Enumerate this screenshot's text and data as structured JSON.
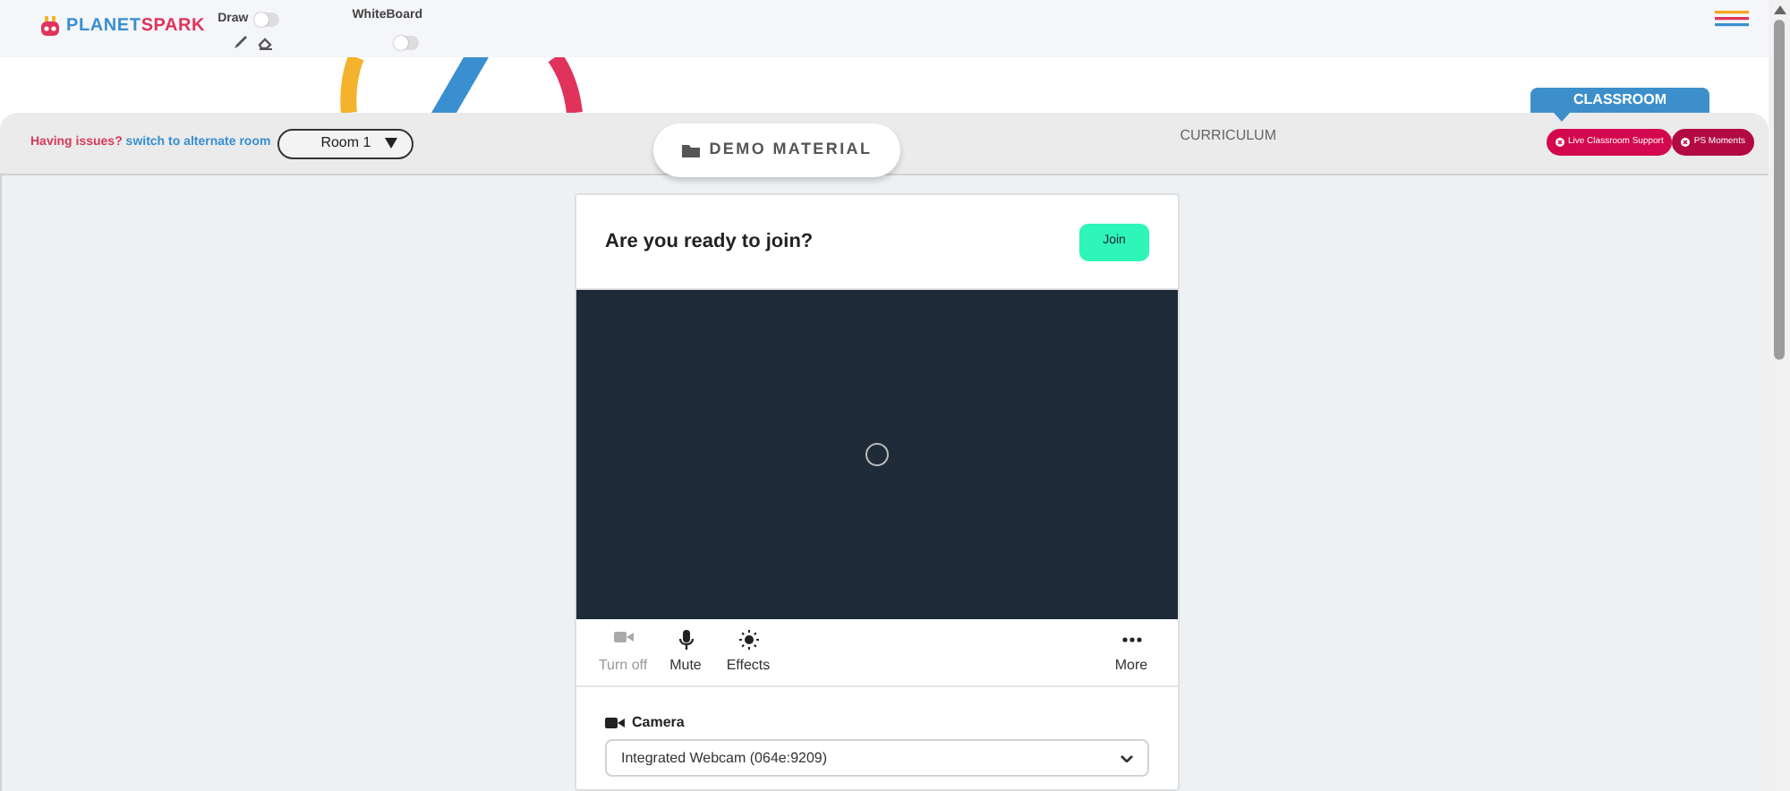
{
  "logo": {
    "part_1": "PLANET",
    "part_2": "SPARK"
  },
  "toggles": [
    {
      "label": "Draw",
      "on": false
    },
    {
      "label": "WhiteBoard",
      "on": false
    }
  ],
  "issue_text": "Having issues?",
  "switch_link": "switch to alternate room",
  "room_select": {
    "value": "Room 1"
  },
  "tabs": [
    {
      "label": "DEMO MATERIAL",
      "selected": true
    },
    {
      "label": "CURRICULUM",
      "selected": false
    }
  ],
  "classroom_label": "CLASSROOM",
  "action_buttons": [
    {
      "label": "Live Classroom Support",
      "color": "#d4084f"
    },
    {
      "label": "PS Moments",
      "color": "#b30a44"
    }
  ],
  "join_card": {
    "title": "Are you ready to join?",
    "join_button": "Join",
    "controls": [
      {
        "kind": "camera",
        "label": "Turn off",
        "disabled": true
      },
      {
        "kind": "mic",
        "label": "Mute",
        "disabled": false
      },
      {
        "kind": "sun",
        "label": "Effects",
        "disabled": false
      },
      {
        "kind": "dots",
        "label": "More",
        "disabled": false
      }
    ],
    "camera_label": "Camera",
    "camera_select": "Integrated Webcam (064e:9209)"
  }
}
